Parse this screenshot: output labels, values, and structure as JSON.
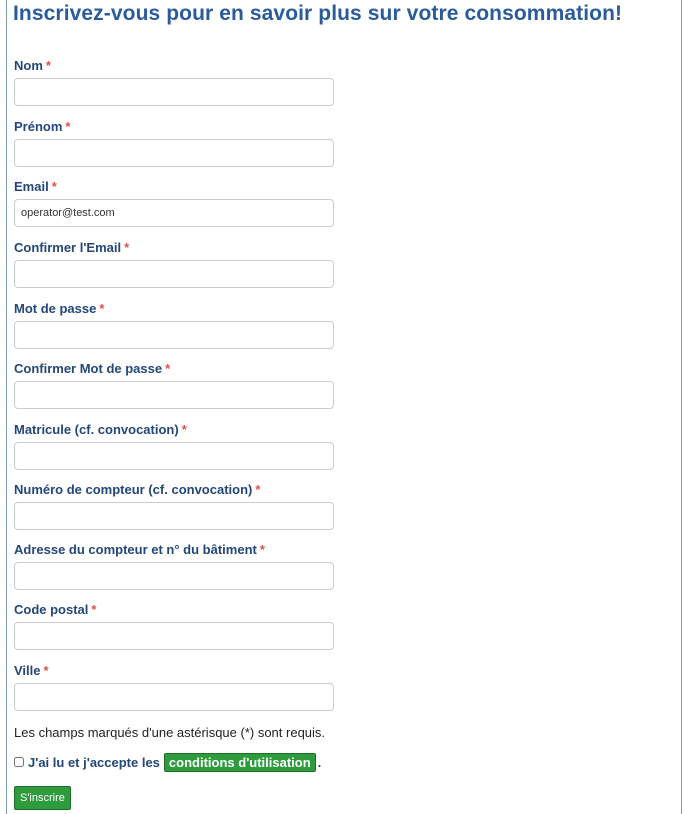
{
  "page": {
    "title": "Inscrivez-vous pour en savoir plus sur votre consommation!"
  },
  "form": {
    "required_marker": "*",
    "fields": [
      {
        "label": "Nom",
        "value": "",
        "placeholder": ""
      },
      {
        "label": "Prénom",
        "value": "",
        "placeholder": ""
      },
      {
        "label": "Email",
        "value": "operator@test.com",
        "placeholder": ""
      },
      {
        "label": "Confirmer l'Email",
        "value": "",
        "placeholder": ""
      },
      {
        "label": "Mot de passe",
        "value": "",
        "placeholder": ""
      },
      {
        "label": "Confirmer Mot de passe",
        "value": "",
        "placeholder": ""
      },
      {
        "label": "Matricule (cf. convocation)",
        "value": "",
        "placeholder": ""
      },
      {
        "label": "Numéro de compteur (cf. convocation)",
        "value": "",
        "placeholder": ""
      },
      {
        "label": "Adresse du compteur et n° du bâtiment",
        "value": "",
        "placeholder": ""
      },
      {
        "label": "Code postal",
        "value": "",
        "placeholder": ""
      },
      {
        "label": "Ville",
        "value": "",
        "placeholder": ""
      }
    ],
    "required_note": "Les champs marqués d'une astérisque (*) sont requis.",
    "accept": {
      "checked": false,
      "text": "J'ai lu et j'accepte les",
      "link_label": "conditions d'utilisation",
      "suffix": "."
    },
    "submit_label": "S'inscrire"
  },
  "colors": {
    "title": "#2a5b9a",
    "label": "#24477a",
    "required": "#d9534f",
    "button_green": "#2e9b3c"
  }
}
